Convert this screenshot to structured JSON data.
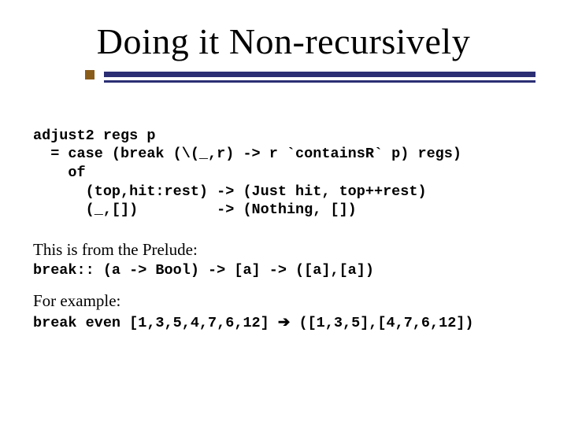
{
  "title": "Doing it Non-recursively",
  "code": {
    "l1": "adjust2 regs p",
    "l2": "  = case (break (\\(_,r) -> r `containsR` p) regs)",
    "l3": "    of",
    "l4": "      (top,hit:rest) -> (Just hit, top++rest)",
    "l5": "      (_,[])         -> (Nothing, [])"
  },
  "prelude_lead": "This is from the Prelude:",
  "prelude_sig": "break:: (a -> Bool) -> [a] -> ([a],[a])",
  "example_lead": "For example:",
  "example_lhs": "break even [1,3,5,4,7,6,12] ",
  "example_arrow": "➔",
  "example_rhs": " ([1,3,5],[4,7,6,12])"
}
